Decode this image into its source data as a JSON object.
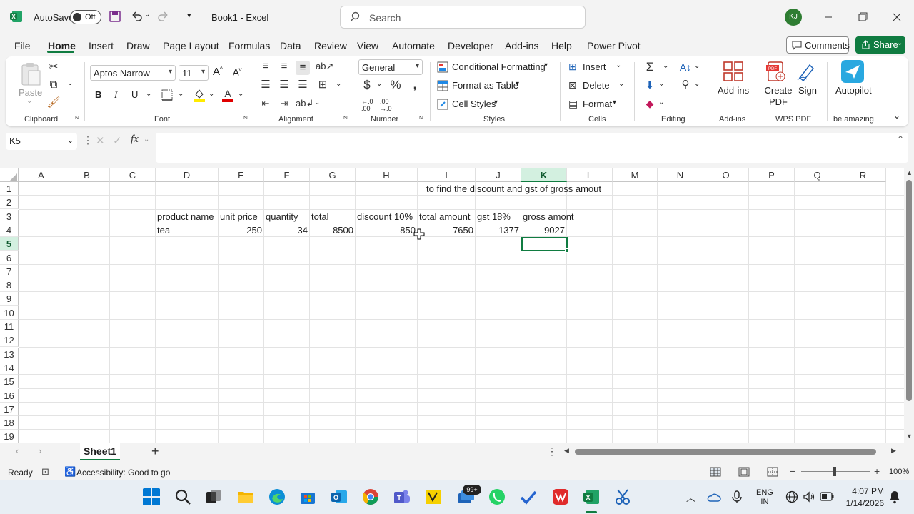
{
  "titlebar": {
    "autosave_label": "AutoSave",
    "autosave_state": "Off",
    "doc_title": "Book1  -  Excel",
    "search_placeholder": "Search",
    "avatar_initials": "KJ"
  },
  "tabs": [
    "File",
    "Home",
    "Insert",
    "Draw",
    "Page Layout",
    "Formulas",
    "Data",
    "Review",
    "View",
    "Automate",
    "Developer",
    "Add-ins",
    "Help",
    "Power Pivot"
  ],
  "active_tab": "Home",
  "buttons": {
    "comments": "Comments",
    "share": "Share"
  },
  "ribbon": {
    "paste": "Paste",
    "font_name": "Aptos Narrow",
    "font_size": "11",
    "number_format": "General",
    "conditional_formatting": "Conditional Formatting",
    "format_as_table": "Format as Table",
    "cell_styles": "Cell Styles",
    "insert": "Insert",
    "delete": "Delete",
    "format": "Format",
    "add_ins": "Add-ins",
    "create_pdf": "Create PDF",
    "sign": "Sign",
    "autopilot": "Autopilot",
    "groups": {
      "clipboard": "Clipboard",
      "font": "Font",
      "alignment": "Alignment",
      "number": "Number",
      "styles": "Styles",
      "cells": "Cells",
      "editing": "Editing",
      "addins": "Add-ins",
      "wps": "WPS PDF",
      "amazing": "be amazing"
    }
  },
  "formula_bar": {
    "name_box": "K5",
    "fx": "fx",
    "content": ""
  },
  "grid": {
    "columns": [
      "A",
      "B",
      "C",
      "D",
      "E",
      "F",
      "G",
      "H",
      "I",
      "J",
      "K",
      "L",
      "M",
      "N",
      "O",
      "P",
      "Q",
      "R"
    ],
    "rows": [
      "1",
      "2",
      "3",
      "4",
      "5",
      "6",
      "7",
      "8",
      "9",
      "10",
      "11",
      "12",
      "13",
      "14",
      "15",
      "16",
      "17",
      "18",
      "19"
    ],
    "selected_column": "K",
    "selected_row": "5",
    "cells": {
      "I1": "to find the discount and gst of gross amout",
      "D3": "product name",
      "E3": "unit price",
      "F3": "quantity",
      "G3": "total",
      "H3": "discount 10%",
      "I3": "total amount",
      "J3": "gst 18%",
      "K3": "gross amont",
      "D4": "tea",
      "E4": "250",
      "F4": "34",
      "G4": "8500",
      "H4": "850",
      "I4": "7650",
      "J4": "1377",
      "K4": "9027"
    }
  },
  "sheets": [
    "Sheet1"
  ],
  "status": {
    "ready": "Ready",
    "accessibility": "Accessibility: Good to go",
    "zoom": "100%"
  },
  "taskbar": {
    "badge": "99+",
    "lang1": "ENG",
    "lang2": "IN",
    "time": "4:07 PM",
    "date": "1/14/2026"
  },
  "colors": {
    "accent": "#107c41",
    "selection_fill": "#d3f0e0"
  }
}
